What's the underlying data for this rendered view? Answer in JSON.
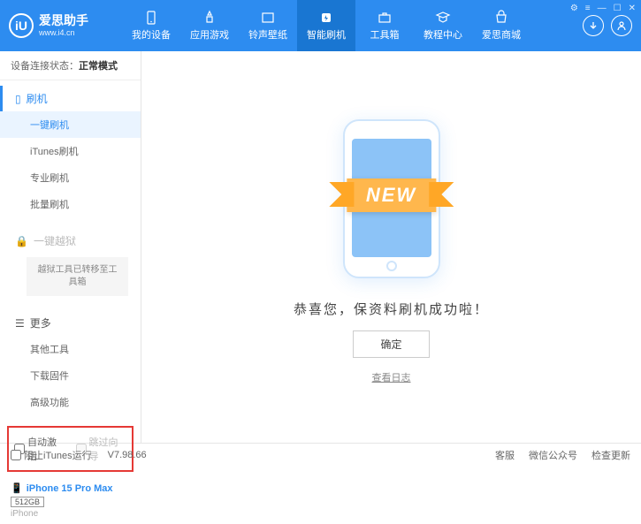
{
  "header": {
    "logo_letter": "iU",
    "logo_title": "爱思助手",
    "logo_url": "www.i4.cn",
    "nav": [
      {
        "label": "我的设备"
      },
      {
        "label": "应用游戏"
      },
      {
        "label": "铃声壁纸"
      },
      {
        "label": "智能刷机"
      },
      {
        "label": "工具箱"
      },
      {
        "label": "教程中心"
      },
      {
        "label": "爱思商城"
      }
    ]
  },
  "sidebar": {
    "conn_label": "设备连接状态：",
    "conn_mode": "正常模式",
    "flash_header": "刷机",
    "items": {
      "one_click": "一键刷机",
      "itunes": "iTunes刷机",
      "pro": "专业刷机",
      "batch": "批量刷机"
    },
    "jailbreak_header": "一键越狱",
    "jailbreak_note": "越狱工具已转移至工具箱",
    "more_header": "更多",
    "more": {
      "other_tools": "其他工具",
      "download_fw": "下载固件",
      "advanced": "高级功能"
    },
    "auto_activate": "自动激活",
    "skip_guide": "跳过向导",
    "device": {
      "name": "iPhone 15 Pro Max",
      "storage": "512GB",
      "type": "iPhone"
    }
  },
  "main": {
    "new_text": "NEW",
    "success": "恭喜您，保资料刷机成功啦！",
    "ok": "确定",
    "view_log": "查看日志"
  },
  "footer": {
    "block_itunes": "阻止iTunes运行",
    "version": "V7.98.66",
    "service": "客服",
    "wechat": "微信公众号",
    "update": "检查更新"
  }
}
